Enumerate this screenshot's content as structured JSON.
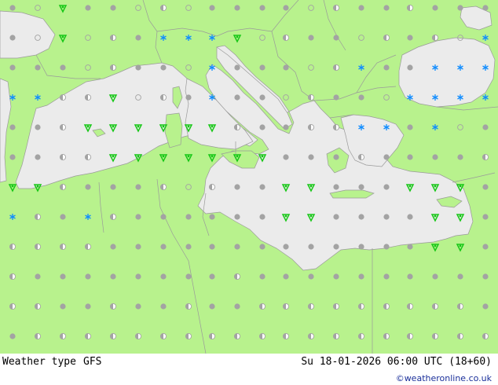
{
  "footer": {
    "product": "Weather type",
    "model": "GFS",
    "valid_time": "Su 18-01-2026 06:00 UTC (18+60)",
    "credit": "©weatheronline.co.uk"
  },
  "colors": {
    "land": "#b8f28d",
    "sea": "#ebebeb",
    "border": "#a0a0a0",
    "dot": "#a3a3a3",
    "rain": "#16c716",
    "snow": "#0f8cff"
  },
  "symbol_types": [
    "cloudy-dot",
    "partly-cloudy-half",
    "clear-circle",
    "drizzle",
    "rain",
    "shower",
    "snow",
    "sleet"
  ]
}
